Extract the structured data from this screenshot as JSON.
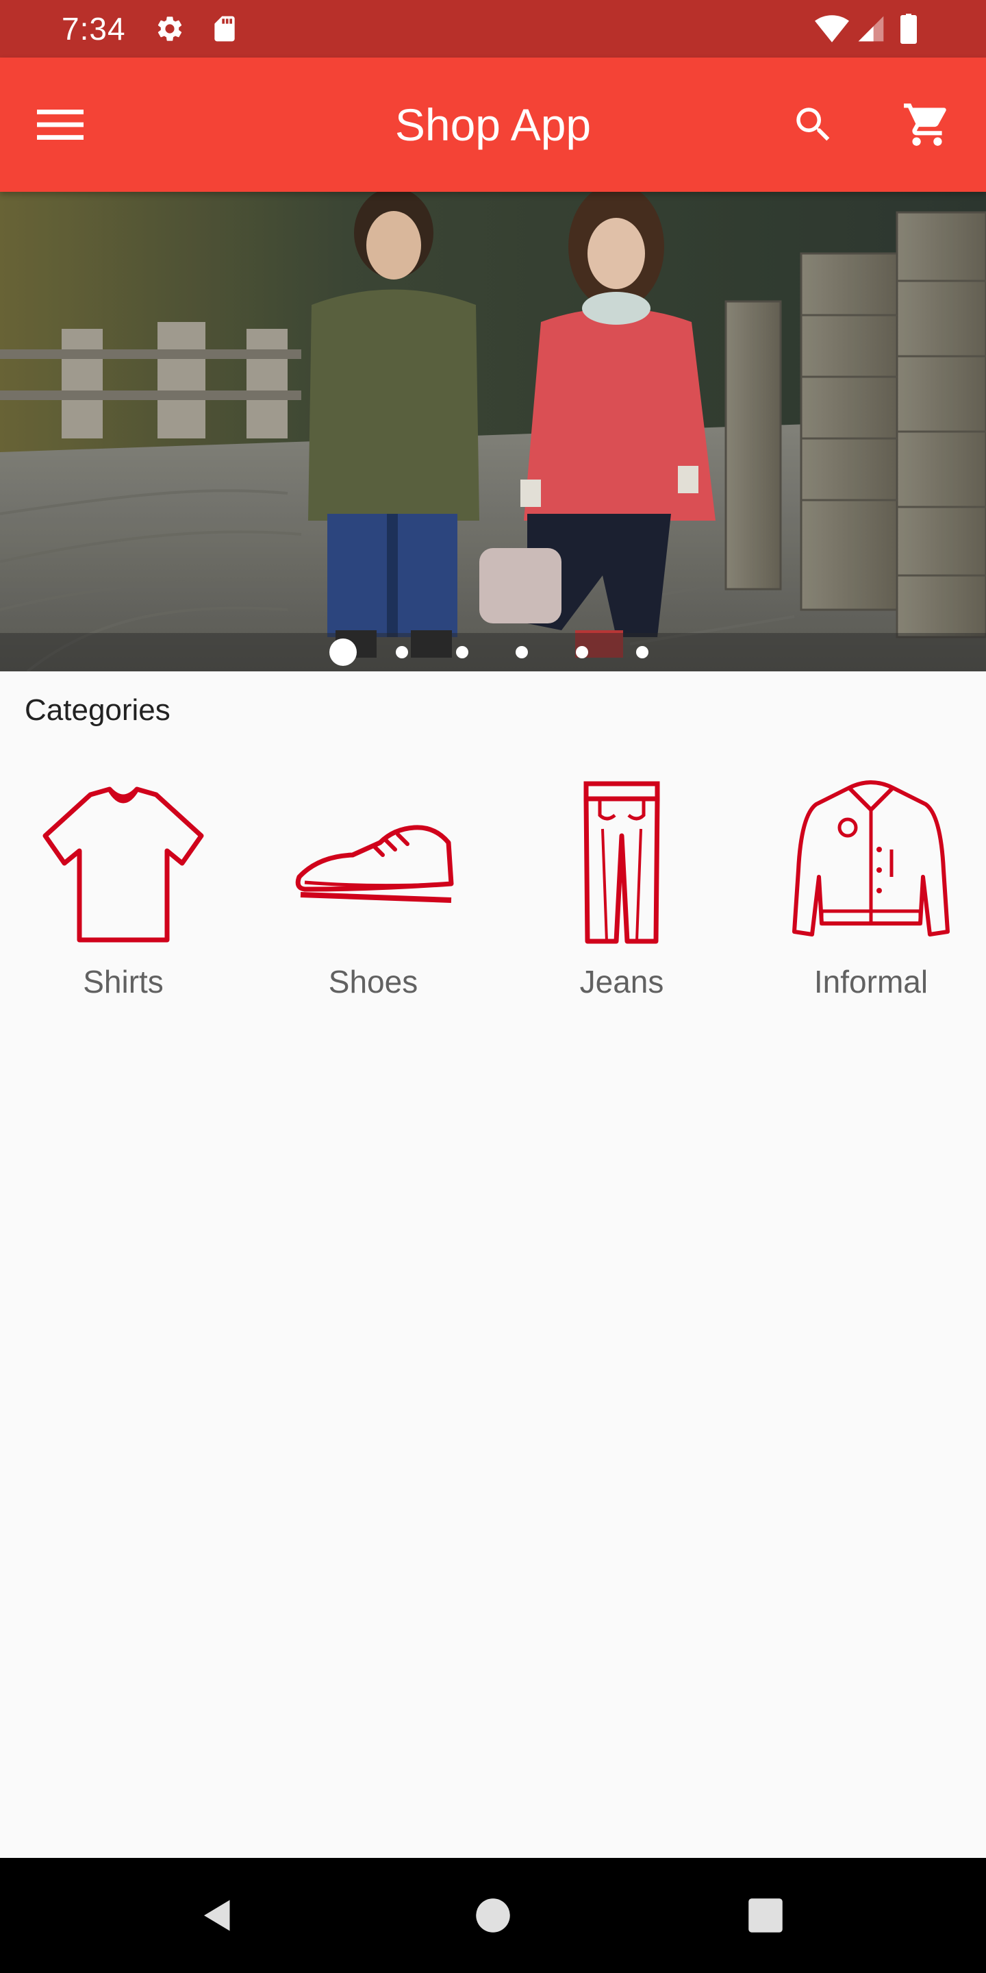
{
  "status_bar": {
    "time": "7:34",
    "icons": [
      "settings-icon",
      "sd-card-icon",
      "wifi-icon",
      "signal-icon",
      "battery-icon"
    ]
  },
  "app_bar": {
    "title": "Shop App",
    "menu_icon": "menu-icon",
    "search_icon": "search-icon",
    "cart_icon": "cart-icon"
  },
  "carousel": {
    "image": "Two children standing on a stone path",
    "slide_count": 6,
    "active_index": 0
  },
  "categories": {
    "title": "Categories",
    "items": [
      {
        "label": "Shirts",
        "icon": "shirt-icon"
      },
      {
        "label": "Shoes",
        "icon": "shoe-icon"
      },
      {
        "label": "Jeans",
        "icon": "jeans-icon"
      },
      {
        "label": "Informal",
        "icon": "jacket-icon"
      }
    ]
  },
  "nav_bar": {
    "icons": [
      "back-icon",
      "home-icon",
      "recents-icon"
    ]
  },
  "colors": {
    "status_bar": "#b8302a",
    "app_bar": "#f44336",
    "accent_icon": "#d0021b",
    "background": "#fafafa"
  }
}
